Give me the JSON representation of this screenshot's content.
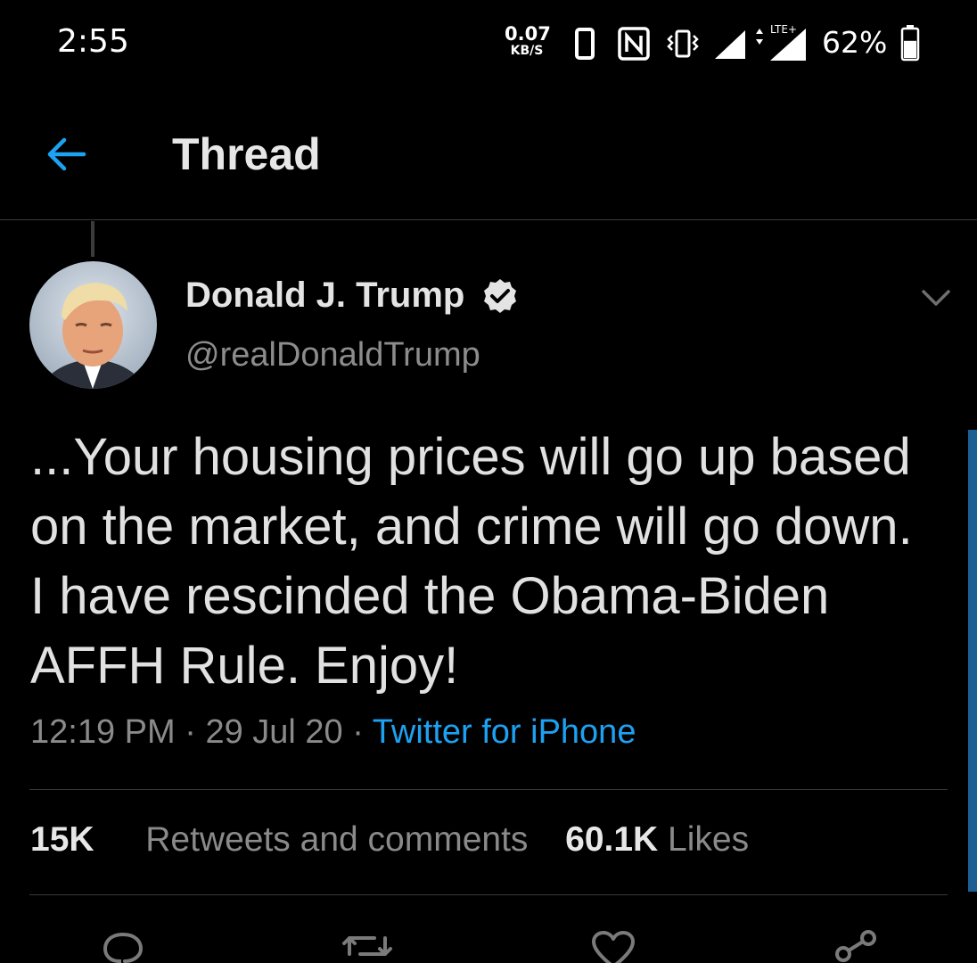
{
  "status_bar": {
    "time": "2:55",
    "net_speed_value": "0.07",
    "net_speed_unit": "KB/S",
    "network_type": "LTE+",
    "battery_percent": "62%",
    "battery_level": 0.62
  },
  "header": {
    "back_icon": "arrow-left-icon",
    "title": "Thread"
  },
  "tweet": {
    "display_name": "Donald J. Trump",
    "handle": "@realDonaldTrump",
    "verified": true,
    "text": "...Your housing prices will go up based on the market, and crime will go down. I have rescinded the Obama-Biden AFFH Rule. Enjoy!",
    "time": "12:19 PM",
    "separator": "·",
    "date": "29 Jul 20",
    "source": "Twitter for iPhone",
    "stats": {
      "retweets_count": "15K",
      "retweets_label": "Retweets and comments",
      "likes_count": "60.1K",
      "likes_label": "Likes"
    },
    "actions": [
      "reply-icon",
      "retweet-icon",
      "like-icon",
      "share-icon"
    ]
  },
  "colors": {
    "background": "#000000",
    "accent": "#1da1f2",
    "secondary_text": "#8a8a8a",
    "primary_text": "#e1e1e1"
  }
}
